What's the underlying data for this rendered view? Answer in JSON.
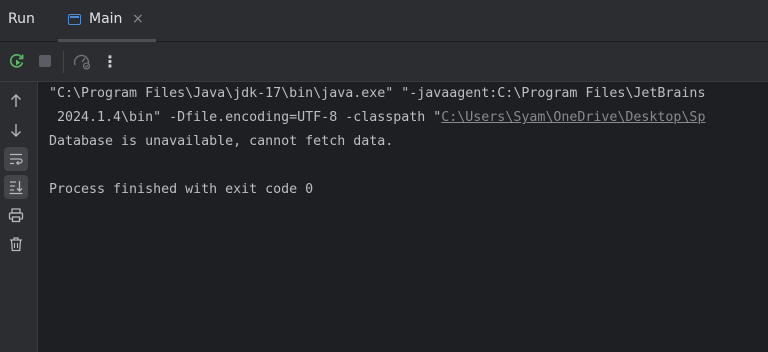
{
  "header": {
    "title": "Run",
    "tab": {
      "label": "Main",
      "close": "×"
    }
  },
  "toolbar": {
    "items": [
      "rerun-icon",
      "stop-icon",
      "profiler-icon",
      "more-options-icon"
    ],
    "more": "⋮"
  },
  "sidebar": {
    "items": [
      "up-arrow-icon",
      "down-arrow-icon",
      "soft-wrap-icon",
      "scroll-to-end-icon",
      "print-icon",
      "trash-icon"
    ]
  },
  "console": {
    "line1": "\"C:\\Program Files\\Java\\jdk-17\\bin\\java.exe\" \"-javaagent:C:\\Program Files\\JetBrains",
    "line2_prefix": " 2024.1.4\\bin\" -Dfile.encoding=UTF-8 -classpath \"",
    "line2_link": "C:\\Users\\Syam\\OneDrive\\Desktop\\Sp",
    "line3": "Database is unavailable, cannot fetch data.",
    "line5": "Process finished with exit code 0"
  },
  "colors": {
    "background": "#1e1f22",
    "panel": "#2b2d30",
    "text": "#bcbec4",
    "rerun_green": "#5fb865",
    "accent_blue": "#4f8cd6"
  }
}
